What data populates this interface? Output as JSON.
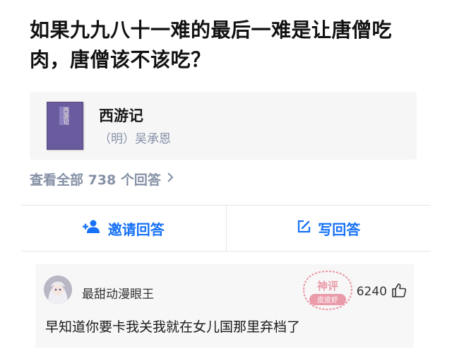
{
  "question": {
    "title": "如果九九八十一难的最后一难是让唐僧吃肉，唐僧该不该吃？"
  },
  "book": {
    "cover_label": "西游记",
    "title": "西游记",
    "author": "（明）吴承恩",
    "cover_color": "#6a5a9e"
  },
  "answers": {
    "view_all_label": "查看全部 738 个回答",
    "chevron_icon": "chevron-right-icon"
  },
  "actions": {
    "invite_label": "邀请回答",
    "invite_icon": "add-user-icon",
    "write_label": "写回答",
    "write_icon": "edit-icon",
    "accent_color": "#1772f6"
  },
  "comment": {
    "user_name": "最甜动漫眼王",
    "like_count": "6240",
    "like_icon": "thumbs-up-icon",
    "text": "早知道你要卡我关我就在女儿国那里弃档了"
  },
  "watermark": {
    "line1": "神评",
    "line2": "皮皮虾",
    "color": "#e0506a"
  }
}
